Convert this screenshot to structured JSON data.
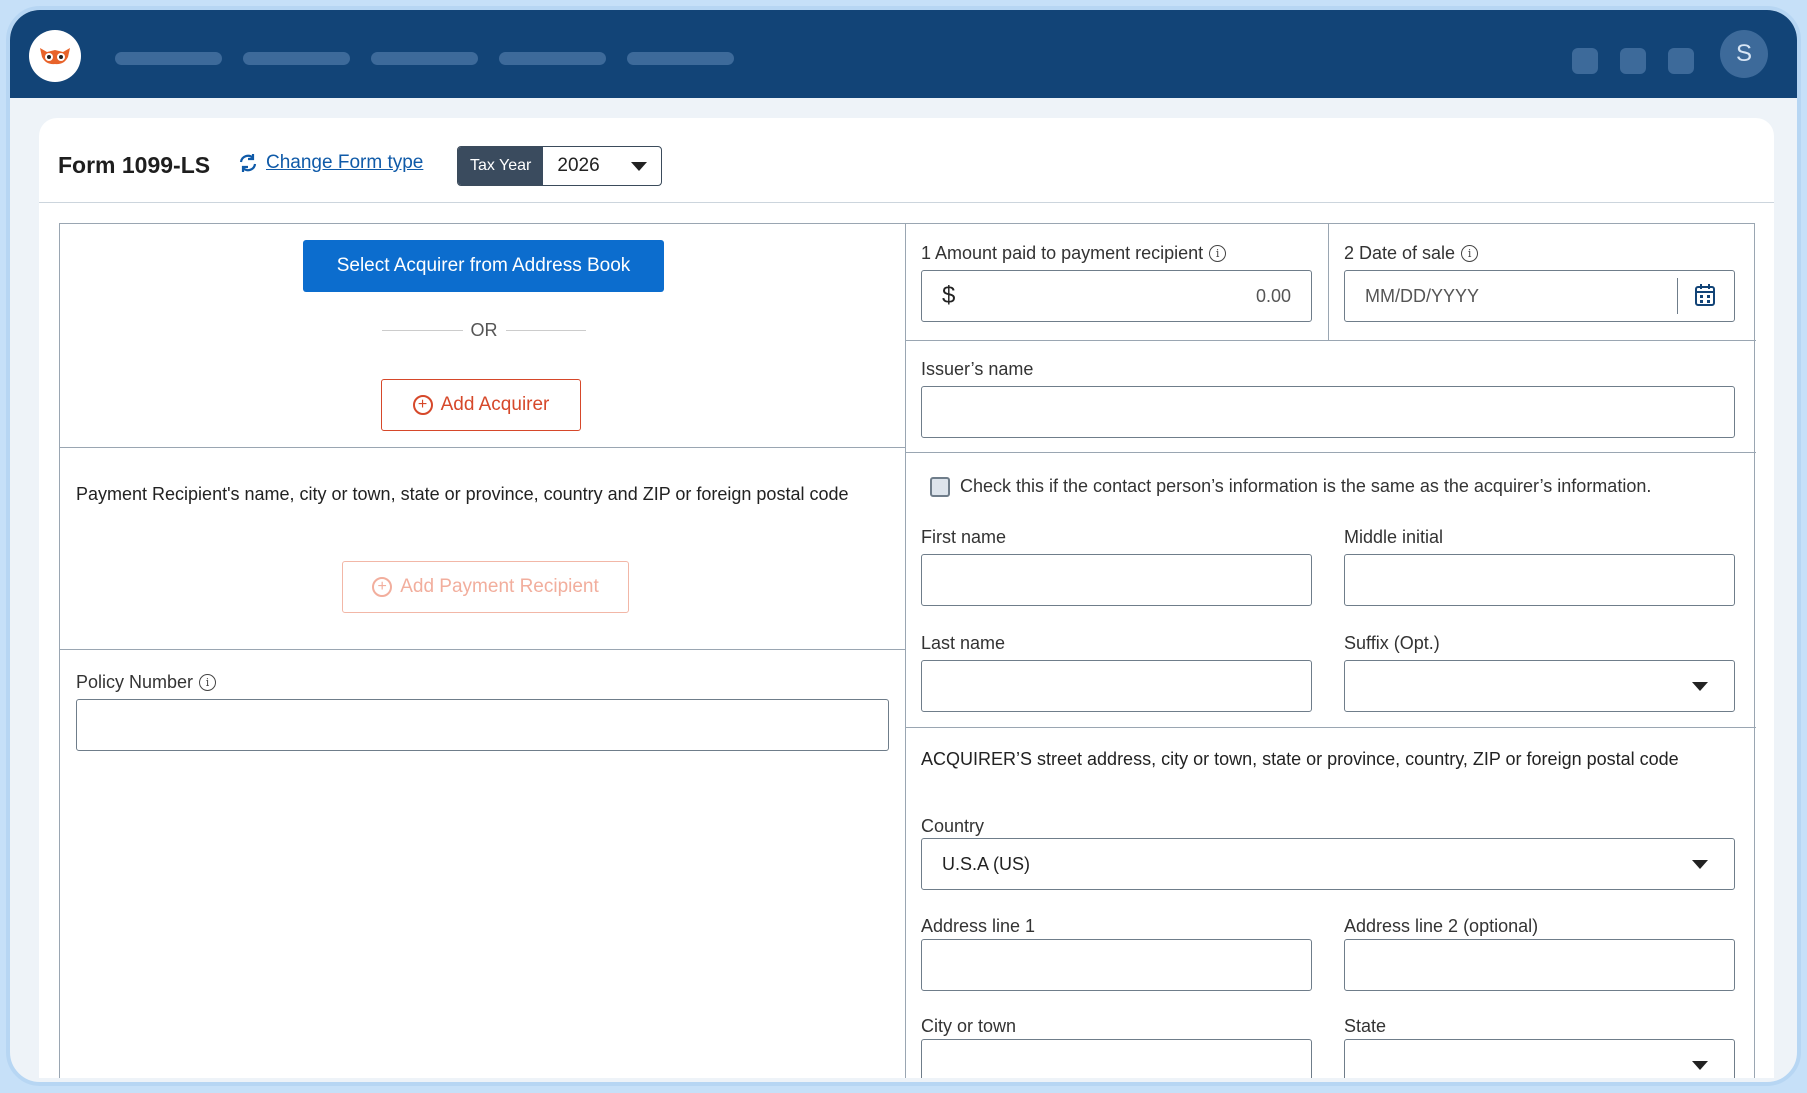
{
  "header": {
    "avatar_letter": "S"
  },
  "page": {
    "form_title": "Form 1099-LS",
    "change_form_label": "Change Form type",
    "tax_year_label": "Tax Year",
    "tax_year_value": "2026"
  },
  "left": {
    "select_acquirer_label": "Select Acquirer from Address Book",
    "or_label": "OR",
    "add_acquirer_label": "Add Acquirer",
    "recipient_heading": "Payment Recipient's name, city or town, state or province, country and ZIP or foreign postal code",
    "add_recipient_label": "Add Payment Recipient",
    "policy_label": "Policy Number"
  },
  "right": {
    "amount_label": "1  Amount paid to payment recipient",
    "amount_currency": "$",
    "amount_value": "0.00",
    "date_label": "2  Date of sale",
    "date_placeholder": "MM/DD/YYYY",
    "issuer_label": "Issuer’s name",
    "same_contact_label": "Check this if the contact person’s information is the same as the acquirer’s information.",
    "first_name_label": "First name",
    "middle_initial_label": "Middle initial",
    "last_name_label": "Last name",
    "suffix_label": "Suffix (Opt.)",
    "address_heading": "ACQUIRER’S street address, city or town, state or province, country, ZIP or foreign postal code",
    "country_label": "Country",
    "country_value": "U.S.A (US)",
    "address1_label": "Address line 1",
    "address2_label": "Address line 2 (optional)",
    "city_label": "City or town",
    "state_label": "State"
  },
  "colors": {
    "topbar": "#124477",
    "primary": "#0c6dce",
    "accent": "#d6482a"
  }
}
